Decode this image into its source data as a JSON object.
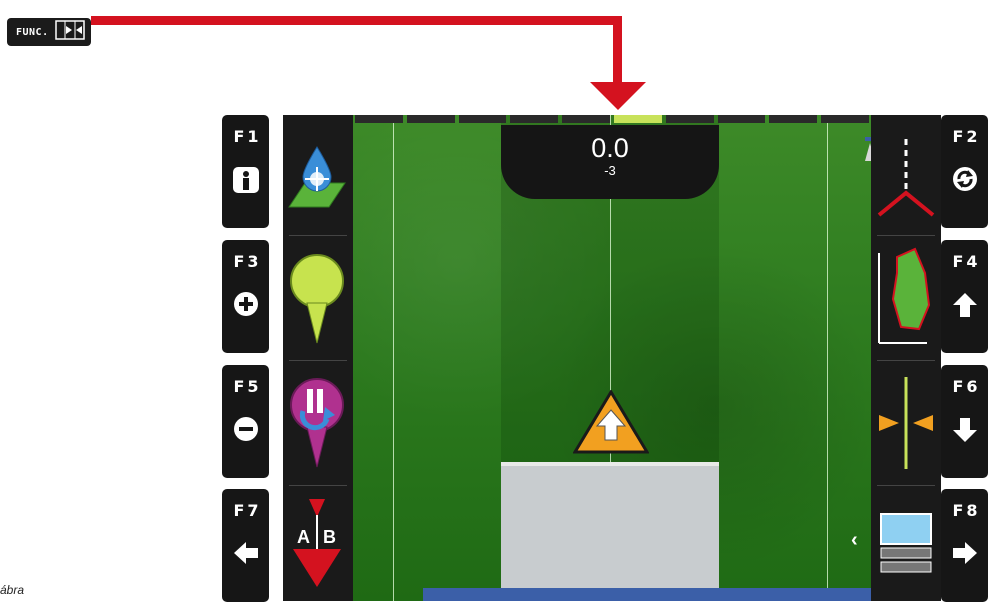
{
  "func_key": {
    "label": "FUNC."
  },
  "fkeys": [
    {
      "label": "F1",
      "icon": "info-icon"
    },
    {
      "label": "F2",
      "icon": "rotate-icon"
    },
    {
      "label": "F3",
      "icon": "plus-icon"
    },
    {
      "label": "F4",
      "icon": "arrow-up-icon"
    },
    {
      "label": "F5",
      "icon": "minus-icon"
    },
    {
      "label": "F6",
      "icon": "arrow-down-icon"
    },
    {
      "label": "F7",
      "icon": "arrow-left-icon"
    },
    {
      "label": "F8",
      "icon": "arrow-right-icon"
    }
  ],
  "readout": {
    "main": "0.0",
    "sub": "-3"
  },
  "side_chevron": "‹",
  "caption": "ábra",
  "colors": {
    "arrow": "#d4121f",
    "field": "#2f7d20",
    "implement": "#c8cccf",
    "bottom_bar": "#3b5fa8",
    "marker": "#c8e25a"
  }
}
